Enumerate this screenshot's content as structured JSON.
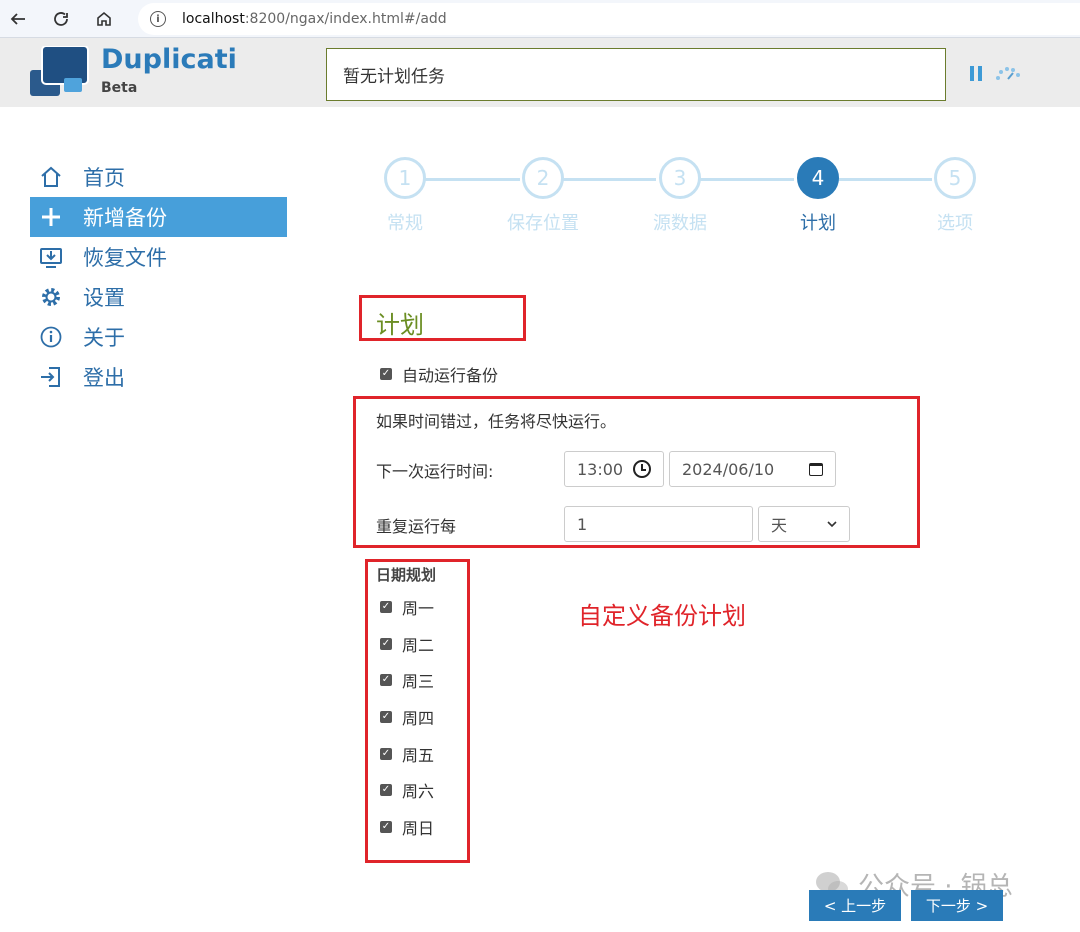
{
  "browser": {
    "url_host": "localhost",
    "url_rest": ":8200/ngax/index.html#/add"
  },
  "header": {
    "brand": "Duplicati",
    "sub": "Beta",
    "status": "暂无计划任务"
  },
  "sidebar": {
    "items": [
      {
        "label": "首页",
        "icon": "home-icon"
      },
      {
        "label": "新增备份",
        "icon": "plus-icon",
        "active": true
      },
      {
        "label": "恢复文件",
        "icon": "restore-icon"
      },
      {
        "label": "设置",
        "icon": "gear-icon"
      },
      {
        "label": "关于",
        "icon": "info-icon"
      },
      {
        "label": "登出",
        "icon": "logout-icon"
      }
    ]
  },
  "steps": [
    {
      "num": "1",
      "label": "常规"
    },
    {
      "num": "2",
      "label": "保存位置"
    },
    {
      "num": "3",
      "label": "源数据"
    },
    {
      "num": "4",
      "label": "计划",
      "active": true
    },
    {
      "num": "5",
      "label": "选项"
    }
  ],
  "schedule": {
    "title": "计划",
    "auto_run": "自动运行备份",
    "note": "如果时间错过，任务将尽快运行。",
    "next_run_label": "下一次运行时间:",
    "time": "13:00",
    "date": "2024/06/10",
    "repeat_label": "重复运行每",
    "repeat_value": "1",
    "repeat_unit": "天",
    "day_plan_title": "日期规划",
    "days": [
      "周一",
      "周二",
      "周三",
      "周四",
      "周五",
      "周六",
      "周日"
    ]
  },
  "annotation": "自定义备份计划",
  "buttons": {
    "prev": "< 上一步",
    "next": "下一步 >"
  },
  "watermark": "公众号 · 锅总",
  "colors": {
    "accent": "#2a7bb8",
    "active_nav": "#479fda",
    "annotation_red": "#e0242a",
    "title_green": "#6b8e23"
  }
}
